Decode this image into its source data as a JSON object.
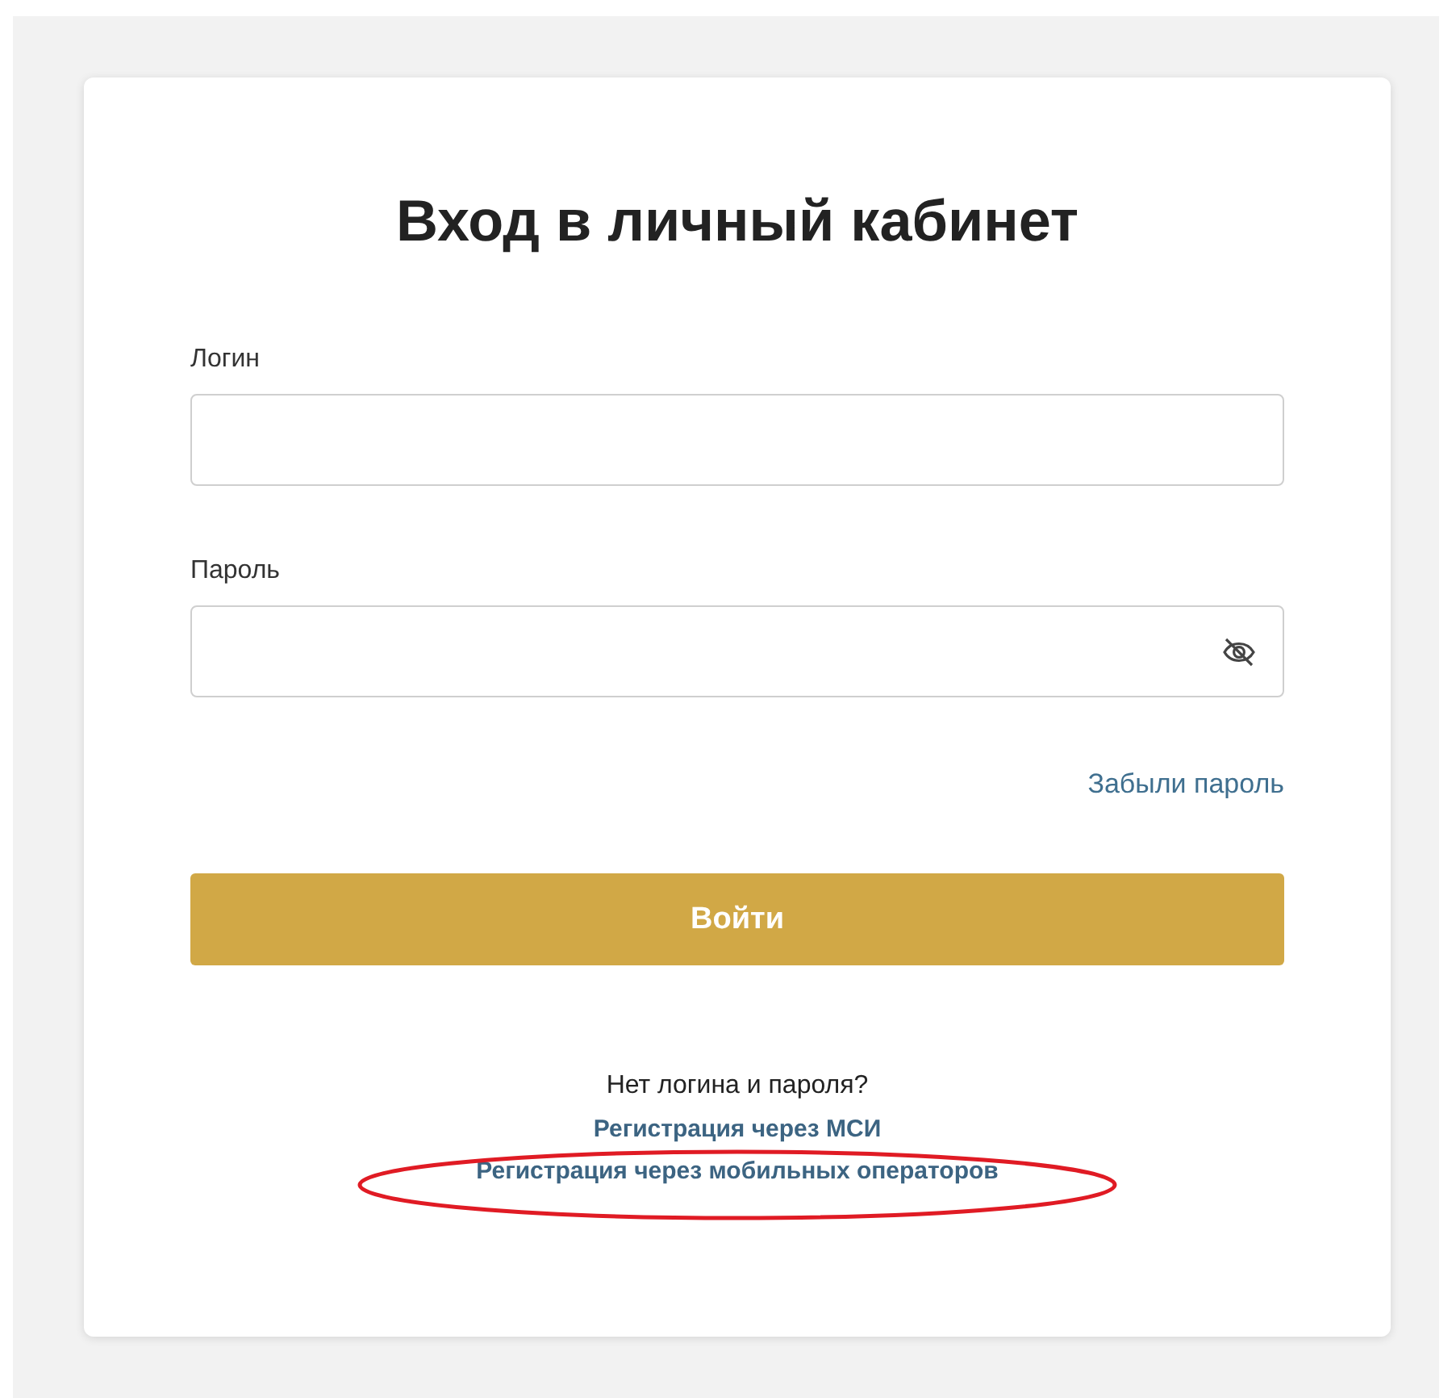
{
  "title": "Вход в личный кабинет",
  "fields": [
    {
      "label": "Логин",
      "kind": "text"
    },
    {
      "label": "Пароль",
      "kind": "password"
    }
  ],
  "forgot_link": "Забыли пароль",
  "submit_button": "Войти",
  "signup_prompt": "Нет логина и пароля?",
  "signup_links": [
    {
      "label": "Регистрация через МСИ",
      "circled": false
    },
    {
      "label": "Регистрация через мобильных операторов",
      "circled": true
    }
  ]
}
